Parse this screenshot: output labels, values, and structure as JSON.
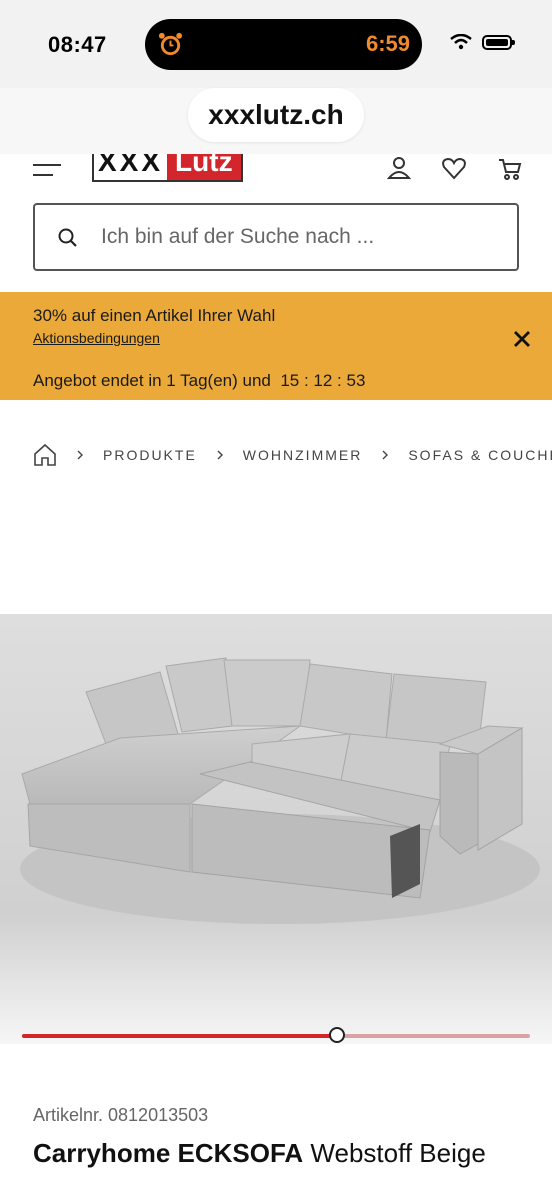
{
  "status_bar": {
    "time": "08:47",
    "timer": "6:59"
  },
  "browser": {
    "url": "xxxlutz.ch"
  },
  "header": {
    "logo_left": "XXX",
    "logo_right": "Lutz"
  },
  "search": {
    "placeholder": "Ich bin auf der Suche nach ..."
  },
  "promo": {
    "text": "30% auf einen Artikel Ihrer Wahl",
    "link": "Aktionsbedingungen",
    "countdown_label": "Angebot endet in 1 Tag(en) und",
    "countdown": "15 : 12 : 53",
    "background": "#eba93a"
  },
  "breadcrumb": {
    "items": [
      "PRODUKTE",
      "WOHNZIMMER",
      "SOFAS & COUCHES"
    ]
  },
  "gallery": {
    "progress_fraction": 0.62,
    "accent": "#d3252c"
  },
  "product": {
    "article_no": "Artikelnr. 0812013503",
    "brand_name": "Carryhome ECKSOFA",
    "variant": "Webstoff Beige"
  }
}
